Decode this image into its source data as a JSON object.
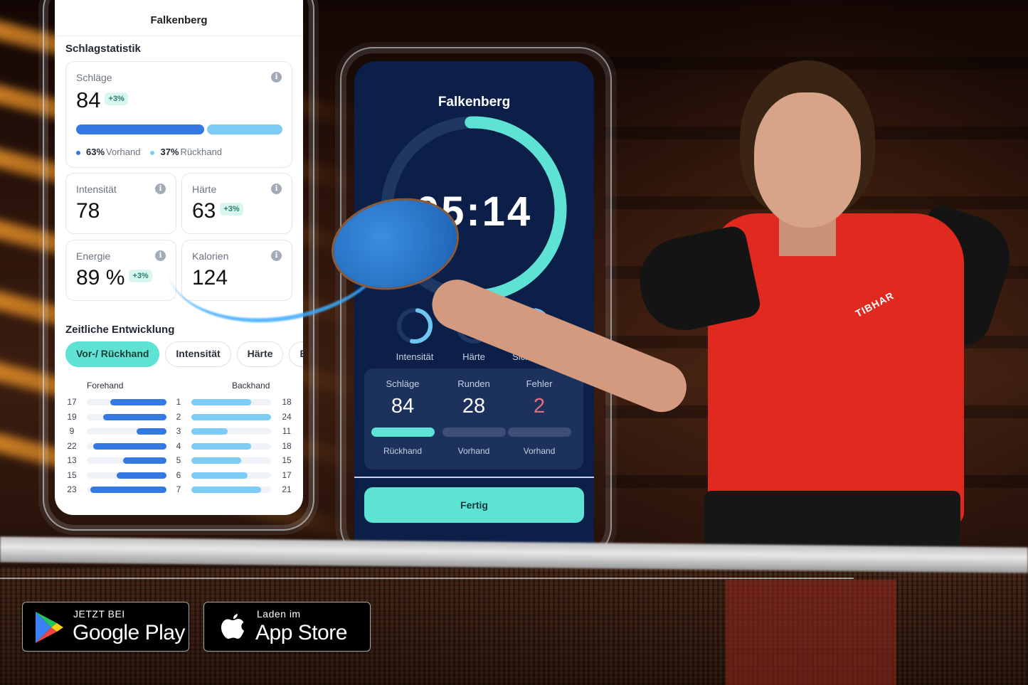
{
  "colors": {
    "accent_teal": "#5ee2d3",
    "forehand_blue": "#3479e2",
    "backhand_blue": "#7dccf5",
    "dark_navy": "#0b1f48",
    "error_pink": "#e0707e",
    "badge_bg": "#d8f6ef"
  },
  "left_phone": {
    "title": "Falkenberg",
    "section_stroke_stats": "Schlagstatistik",
    "strokes_card": {
      "label": "Schläge",
      "value": "84",
      "badge": "+3%",
      "forehand_pct": 63,
      "backhand_pct": 37,
      "forehand_pct_text": "63%",
      "forehand_label": "Vorhand",
      "backhand_pct_text": "37%",
      "backhand_label": "Rückhand"
    },
    "metric_cards": [
      {
        "label": "Intensität",
        "value": "78",
        "badge": ""
      },
      {
        "label": "Härte",
        "value": "63",
        "badge": "+3%"
      },
      {
        "label": "Energie",
        "value": "89 %",
        "badge": "+3%"
      },
      {
        "label": "Kalorien",
        "value": "124",
        "badge": ""
      }
    ],
    "section_timeline": "Zeitliche Entwicklung",
    "chips": [
      {
        "label": "Vor-/ Rückhand",
        "active": true
      },
      {
        "label": "Intensität",
        "active": false
      },
      {
        "label": "Härte",
        "active": false
      },
      {
        "label": "E",
        "active": false
      }
    ],
    "forehand_header": "Forehand",
    "backhand_header": "Backhand",
    "chart_max": 24,
    "rows": [
      {
        "index": "1",
        "forehand": 17,
        "backhand": 18
      },
      {
        "index": "2",
        "forehand": 19,
        "backhand": 24
      },
      {
        "index": "3",
        "forehand": 9,
        "backhand": 11
      },
      {
        "index": "4",
        "forehand": 22,
        "backhand": 18
      },
      {
        "index": "5",
        "forehand": 13,
        "backhand": 15
      },
      {
        "index": "6",
        "forehand": 15,
        "backhand": 17
      },
      {
        "index": "7",
        "forehand": 23,
        "backhand": 21
      }
    ]
  },
  "right_phone": {
    "title": "Falkenberg",
    "timer": "05:14",
    "timer_progress": 0.5,
    "mini_rings": [
      {
        "label": "Intensität",
        "progress": 0.5
      },
      {
        "label": "Härte",
        "progress": 0.33
      },
      {
        "label": "Sicherheit",
        "progress": 0.25
      }
    ],
    "stats": [
      {
        "label": "Schläge",
        "value": "84",
        "bar_label": "Rückhand",
        "highlight": true,
        "error": false
      },
      {
        "label": "Runden",
        "value": "28",
        "bar_label": "Vorhand",
        "highlight": false,
        "error": false
      },
      {
        "label": "Fehler",
        "value": "2",
        "bar_label": "Vorhand",
        "highlight": false,
        "error": true
      }
    ],
    "done_button": "Fertig"
  },
  "store_badges": {
    "google_small": "JETZT BEI",
    "google_big": "Google Play",
    "apple_small": "Laden im",
    "apple_big": "App Store"
  },
  "photo": {
    "shirt_brand": "TIBHAR"
  }
}
